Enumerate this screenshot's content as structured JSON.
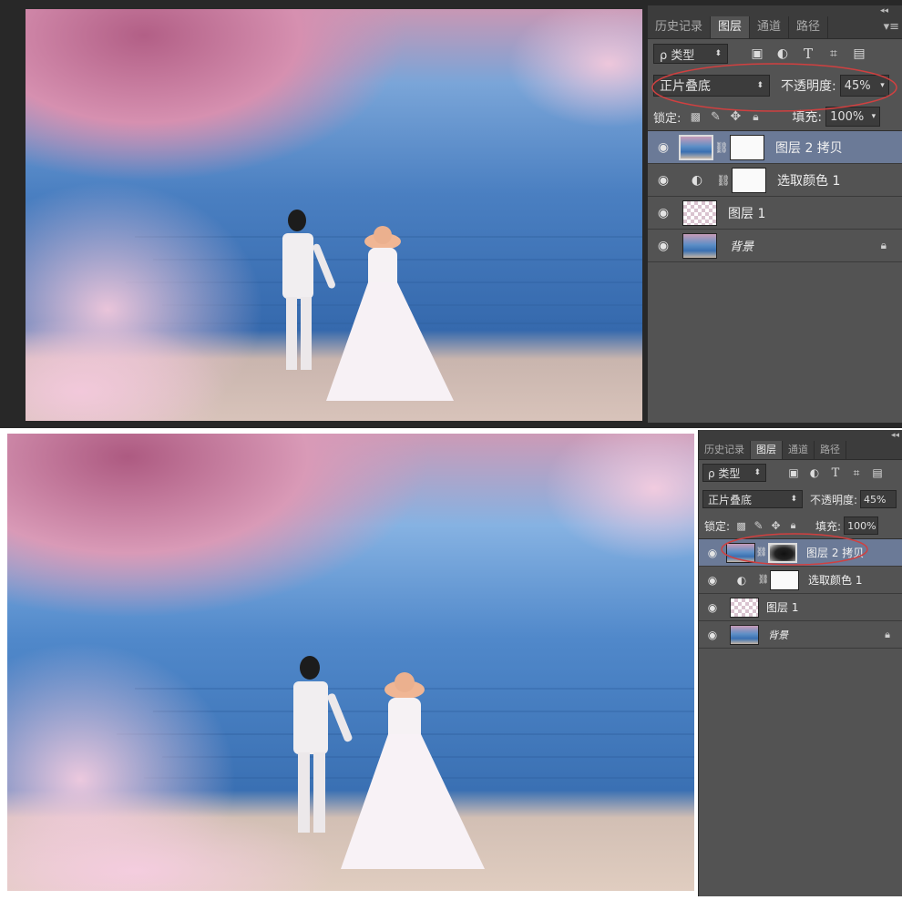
{
  "panel": {
    "collapse_icon": "double-chevron-icon",
    "tabs": [
      {
        "label": "历史记录",
        "active": false
      },
      {
        "label": "图层",
        "active": true
      },
      {
        "label": "通道",
        "active": false
      },
      {
        "label": "路径",
        "active": false
      }
    ],
    "menu_icon": "panel-menu-icon",
    "filter": {
      "kind_label": "ρ 类型",
      "filter_icons": [
        "image-filter-icon",
        "adjustment-filter-icon",
        "type-filter-icon",
        "shape-filter-icon",
        "smart-object-filter-icon"
      ]
    },
    "blend_mode": "正片叠底",
    "opacity_label": "不透明度:",
    "opacity_value": "45%",
    "lock_label": "锁定:",
    "lock_icons": [
      "lock-transparent-icon",
      "lock-brush-icon",
      "lock-move-icon",
      "lock-all-icon"
    ],
    "fill_label": "填充:",
    "fill_value": "100%"
  },
  "layers_top": [
    {
      "name": "图层 2 拷贝",
      "selected": true,
      "thumb": "photo",
      "mask": "white"
    },
    {
      "name": "选取颜色 1",
      "selected": false,
      "thumb": "adjustment",
      "mask": "white"
    },
    {
      "name": "图层 1",
      "selected": false,
      "thumb": "checker"
    },
    {
      "name": "背景",
      "selected": false,
      "thumb": "photo",
      "locked": true
    }
  ],
  "layers_bottom": [
    {
      "name": "图层 2 拷贝",
      "selected": true,
      "thumb": "photo",
      "mask": "dark"
    },
    {
      "name": "选取颜色 1",
      "selected": false,
      "thumb": "adjustment",
      "mask": "white"
    },
    {
      "name": "图层 1",
      "selected": false,
      "thumb": "checker"
    },
    {
      "name": "背景",
      "selected": false,
      "thumb": "photo",
      "locked": true
    }
  ],
  "colors": {
    "panel_bg": "#535353",
    "selected_row": "#6b7a97",
    "annotation": "#d04040",
    "sea": "#3e74b8",
    "blossom": "#c77a9a"
  }
}
